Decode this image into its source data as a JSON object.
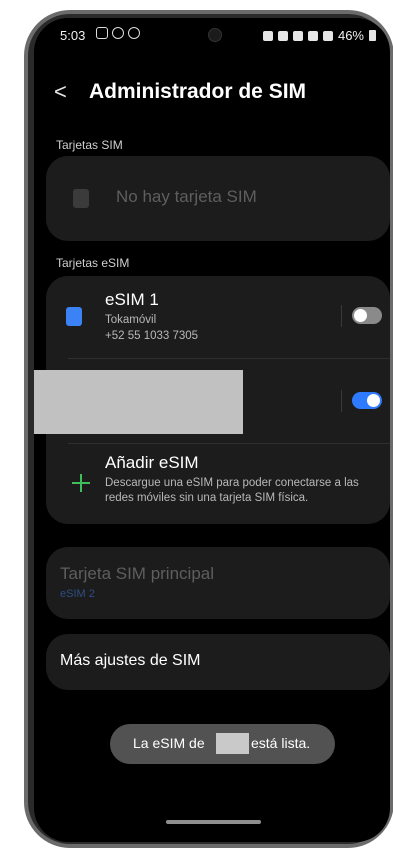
{
  "status_bar": {
    "time": "5:03",
    "battery_percent": "46%"
  },
  "header": {
    "back_icon": "chevron-left-icon",
    "back_glyph": "<",
    "title": "Administrador de SIM"
  },
  "sections": {
    "sim_cards_label": "Tarjetas SIM",
    "esim_cards_label": "Tarjetas eSIM"
  },
  "physical_sim": {
    "empty_text": "No hay tarjeta SIM"
  },
  "esims": [
    {
      "name": "eSIM 1",
      "carrier": "Tokamóvil",
      "number": "+52 55 1033 7305",
      "enabled": false
    },
    {
      "enabled": true
    }
  ],
  "add_esim": {
    "title": "Añadir eSIM",
    "description": "Descargue una eSIM para poder conectarse a las redes móviles sin una tarjeta SIM física."
  },
  "primary_sim": {
    "label": "Tarjeta SIM principal",
    "value": "eSIM 2"
  },
  "more_settings": {
    "label": "Más ajustes de SIM"
  },
  "toast": {
    "before": "La eSIM de",
    "after": "está lista."
  },
  "colors": {
    "accent": "#2f7bff",
    "add_icon": "#3fbf5a",
    "card_bg": "#1c1c1c",
    "sim_icon_active": "#3b82f6"
  }
}
